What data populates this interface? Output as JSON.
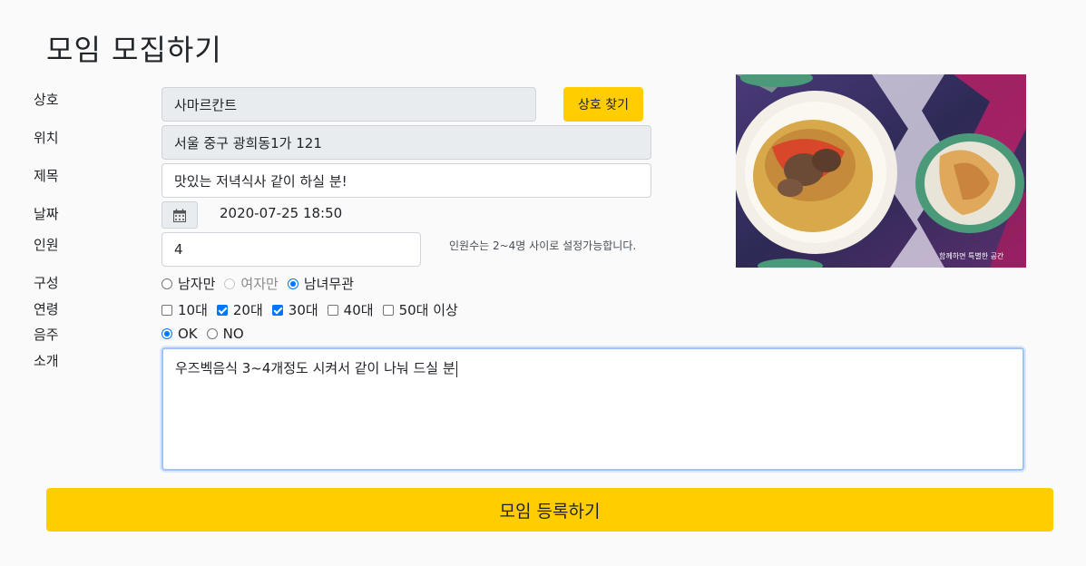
{
  "page": {
    "title": "모임 모집하기"
  },
  "labels": {
    "store": "상호",
    "location": "위치",
    "subject": "제목",
    "date": "날짜",
    "people": "인원",
    "composition": "구성",
    "age": "연령",
    "drinking": "음주",
    "intro": "소개"
  },
  "store": {
    "value": "사마르칸트",
    "search_button": "상호 찾기"
  },
  "location": {
    "value": "서울 중구 광희동1가 121"
  },
  "subject": {
    "value": "맛있는 저녁식사 같이 하실 분!"
  },
  "date": {
    "value": "2020-07-25 18:50",
    "icon": "calendar-icon"
  },
  "people": {
    "value": "4",
    "hint": "인원수는 2~4명 사이로 설정가능합니다."
  },
  "composition": {
    "options": [
      {
        "label": "남자만",
        "checked": false,
        "disabled": false
      },
      {
        "label": "여자만",
        "checked": false,
        "disabled": true
      },
      {
        "label": "남녀무관",
        "checked": true,
        "disabled": false
      }
    ]
  },
  "age": {
    "options": [
      {
        "label": "10대",
        "checked": false
      },
      {
        "label": "20대",
        "checked": true
      },
      {
        "label": "30대",
        "checked": true
      },
      {
        "label": "40대",
        "checked": false
      },
      {
        "label": "50대 이상",
        "checked": false
      }
    ]
  },
  "drinking": {
    "options": [
      {
        "label": "OK",
        "checked": true
      },
      {
        "label": "NO",
        "checked": false
      }
    ]
  },
  "intro": {
    "value": "우즈벡음식 3~4개정도 시켜서 같이 나눠 드실 분"
  },
  "photo": {
    "caption": "함께하면 특별한 공간"
  },
  "submit": {
    "label": "모임 등록하기"
  },
  "colors": {
    "accent": "#ffcd00",
    "focus": "#9ec5f8",
    "check": "#0075ff"
  }
}
